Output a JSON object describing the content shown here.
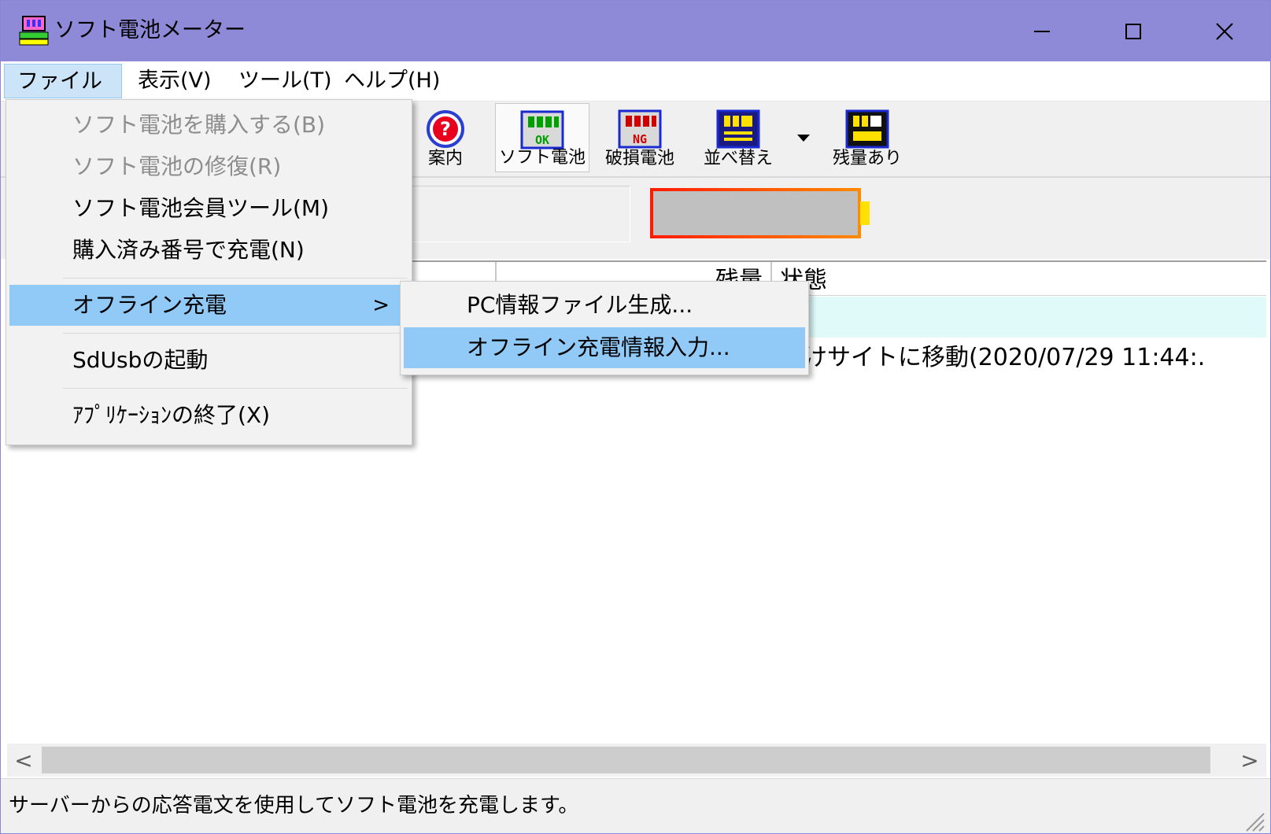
{
  "window": {
    "title": "ソフト電池メーター",
    "title_bar_color": "#8f8ad8",
    "controls": {
      "minimize": "minimize-icon",
      "maximize": "maximize-icon",
      "close": "close-icon"
    }
  },
  "menubar": {
    "items": [
      {
        "label": "ファイル(F)",
        "active": true
      },
      {
        "label": "表示(V)"
      },
      {
        "label": "ツール(T)"
      },
      {
        "label": "ヘルプ(H)"
      }
    ]
  },
  "toolbar": {
    "buttons": [
      {
        "label": "案内",
        "icon": "help-question-icon"
      },
      {
        "label": "ソフト電池",
        "icon": "battery-ok-icon",
        "badge": "OK",
        "pressed": true
      },
      {
        "label": "破損電池",
        "icon": "battery-ng-icon",
        "badge": "NG"
      },
      {
        "label": "並べ替え",
        "icon": "sort-icon"
      },
      {
        "label": "残量あり",
        "icon": "battery-remaining-icon"
      }
    ],
    "dropdown_icon": "dropdown-arrow-icon"
  },
  "gauge": {
    "level": 0,
    "frame_color": "#ff2a00",
    "terminal_color": "#ffe000"
  },
  "list": {
    "columns": [
      "残量",
      "状態"
    ],
    "rows": [
      {
        "status": ""
      },
      {
        "status": "頂けサイトに移動(2020/07/29 11:44:."
      }
    ]
  },
  "scrollbar": {
    "left_arrow": "<",
    "right_arrow": ">"
  },
  "status_bar": {
    "text": "サーバーからの応答電文を使用してソフト電池を充電します。"
  },
  "file_menu": {
    "items": [
      {
        "label": "ソフト電池を購入する(B)",
        "disabled": true
      },
      {
        "label": "ソフト電池の修復(R)",
        "disabled": true
      },
      {
        "label": "ソフト電池会員ツール(M)"
      },
      {
        "label": "購入済み番号で充電(N)"
      },
      {
        "label": "オフライン充電",
        "submenu": true,
        "highlighted": true,
        "arrow": ">"
      },
      {
        "label": "SdUsbの起動"
      },
      {
        "label": "ｱﾌﾟﾘｹｰｼｮﾝの終了(X)"
      }
    ]
  },
  "offline_submenu": {
    "items": [
      {
        "label": "PC情報ファイル生成..."
      },
      {
        "label": "オフライン充電情報入力...",
        "highlighted": true
      }
    ]
  }
}
